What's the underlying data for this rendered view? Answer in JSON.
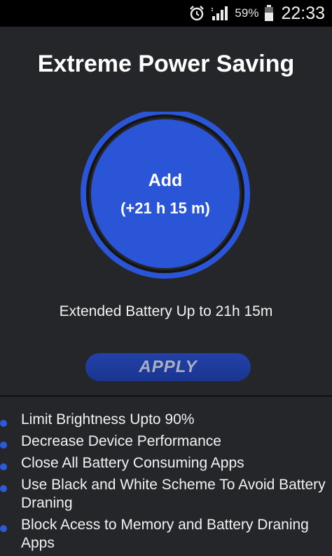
{
  "status_bar": {
    "icons": [
      "alarm-icon",
      "signal-icon",
      "battery-icon"
    ],
    "battery_percent": "59%",
    "time": "22:33"
  },
  "title": "Extreme Power Saving",
  "boost": {
    "label": "Add",
    "value": "(+21 h 15 m)",
    "ring_color": "#2a55d6"
  },
  "extended_text": "Extended Battery Up to 21h 15m",
  "apply_label": "APPLY",
  "features": [
    "Limit Brightness Upto 90%",
    "Decrease Device Performance",
    "Close All Battery Consuming Apps",
    "Use Black and White Scheme To Avoid Battery Draning",
    "Block Acess to Memory and Battery Draning Apps"
  ],
  "colors": {
    "background": "#252629",
    "accent": "#2a55d6",
    "bullet": "#2d5bd8"
  }
}
